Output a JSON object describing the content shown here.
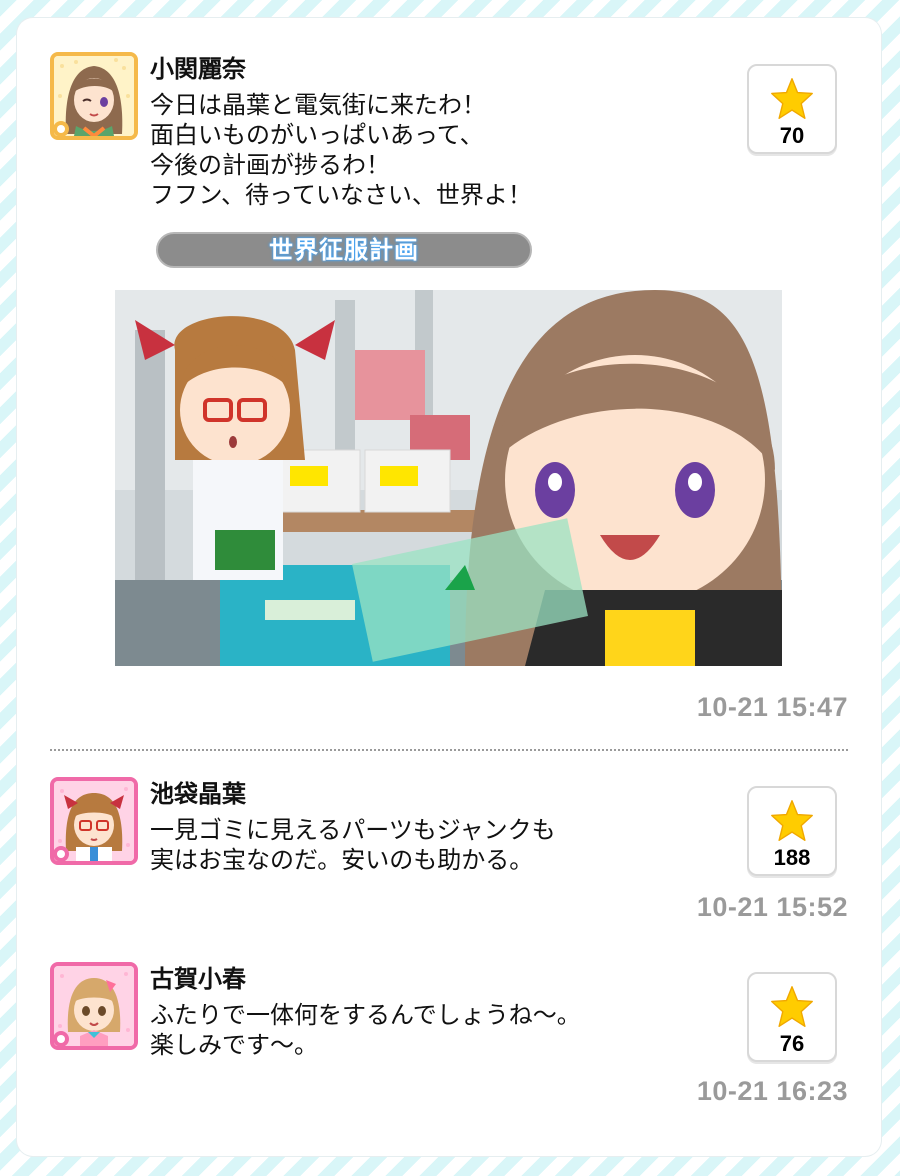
{
  "posts": [
    {
      "author": "小関麗奈",
      "lines": [
        "今日は晶葉と電気街に来たわ！",
        "面白いものがいっぱいあって、",
        "今後の計画が捗るわ！",
        "フフン、待っていなさい、世界よ！"
      ],
      "tag": "世界征服計画",
      "likes": "70",
      "timestamp": "10-21 15:47",
      "avatar_frame_color": "#f5b94a"
    },
    {
      "author": "池袋晶葉",
      "lines": [
        "一見ゴミに見えるパーツもジャンクも",
        "実はお宝なのだ。安いのも助かる。"
      ],
      "likes": "188",
      "timestamp": "10-21 15:52",
      "avatar_frame_color": "#f06aa8"
    },
    {
      "author": "古賀小春",
      "lines": [
        "ふたりで一体何をするんでしょうね〜。",
        "楽しみです〜。"
      ],
      "likes": "76",
      "timestamp": "10-21 16:23",
      "avatar_frame_color": "#f06aa8"
    }
  ],
  "icons": {
    "like": "star-icon",
    "rank": "flower-badge-icon"
  },
  "colors": {
    "star": "#ffcc00",
    "timestamp": "#9a9a9a",
    "tag_bg": "#8c8c8c",
    "tag_glow": "#3ea6ff"
  }
}
